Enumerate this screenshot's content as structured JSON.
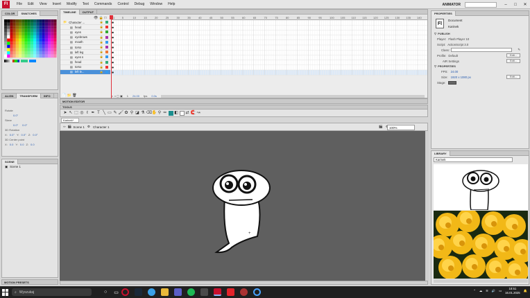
{
  "menubar": {
    "logo": "Fl",
    "items": [
      "File",
      "Edit",
      "View",
      "Insert",
      "Modify",
      "Text",
      "Commands",
      "Control",
      "Debug",
      "Window",
      "Help"
    ],
    "workspace": "ANIMATOR"
  },
  "color_panel": {
    "tabs": [
      "COLOR",
      "SWATCHES"
    ]
  },
  "transform_panel": {
    "tabs": [
      "ALIGN",
      "TRANSFORM",
      "INFO"
    ],
    "rotate_label": "Rotate",
    "rotate_value": "0.0°",
    "skew_label": "Skew",
    "skew_values": [
      "0.0°",
      "0.0°"
    ],
    "rotation3d_label": "3D Rotation",
    "rotation3d_values": [
      "0.0°",
      "0.0°",
      "0.0°"
    ],
    "center3d_label": "3D Center point",
    "center3d_values": [
      "0.0",
      "0.0",
      "0.0"
    ]
  },
  "scene_panel": {
    "title": "SCENE",
    "scenes": [
      "Scene 1"
    ]
  },
  "motion_presets": {
    "title": "MOTION PRESETS"
  },
  "timeline": {
    "tabs": [
      "TIMELINE",
      "OUTPUT"
    ],
    "layers": [
      "Character ...",
      "head",
      "eyes",
      "eyebrows",
      "mouth",
      "torso",
      "left leg",
      "eyes s",
      "head",
      "torso",
      "left le..."
    ],
    "ruler": [
      "1",
      "5",
      "10",
      "15",
      "20",
      "25",
      "30",
      "35",
      "40",
      "45",
      "50",
      "55",
      "60",
      "65",
      "70",
      "75",
      "80",
      "85",
      "90",
      "95",
      "100",
      "105",
      "110",
      "115",
      "120",
      "125",
      "130",
      "135",
      "140"
    ],
    "status": {
      "frame": "1",
      "fps": "24.00",
      "fps_unit": "fps",
      "time": "0.0s"
    }
  },
  "motion_editor": {
    "title": "MOTION EDITOR"
  },
  "tools": {
    "title": "TOOLS"
  },
  "document": {
    "tab": "Karinek*",
    "breadcrumb": [
      "Scene 1",
      "Character 1"
    ],
    "zoom": "100%"
  },
  "properties": {
    "title": "PROPERTIES",
    "doc_type": "Document",
    "doc_name": "Karinek",
    "publish_header": "PUBLISH",
    "player_label": "Player:",
    "player_value": "Flash Player 10",
    "script_label": "Script:",
    "script_value": "ActionScript 3.0",
    "class_label": "Class:",
    "profile_label": "Profile:",
    "profile_value": "Default",
    "air_label": "AIR Settings",
    "edit_label": "Edit...",
    "props_header": "PROPERTIES",
    "fps_label": "FPS:",
    "fps_value": "24.00",
    "size_label": "Size:",
    "size_value": "1920 x 1080 px",
    "stage_label": "Stage:"
  },
  "library": {
    "title": "LIBRARY",
    "doc": "Karinek"
  },
  "taskbar": {
    "search_placeholder": "Wyszukaj",
    "time": "18:51",
    "date": "16.01.2025"
  }
}
